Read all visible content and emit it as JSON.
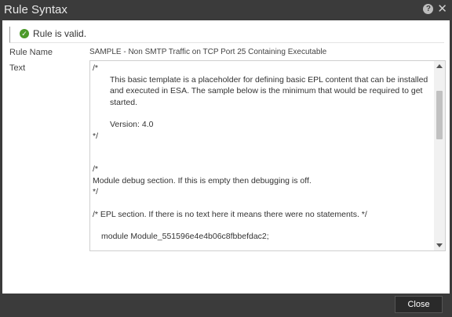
{
  "dialog": {
    "title": "Rule Syntax",
    "help_icon": "?",
    "close_icon": "✕"
  },
  "status": {
    "message": "Rule is valid.",
    "icon": "check-circle-icon"
  },
  "fields": {
    "rule_name_label": "Rule Name",
    "rule_name_value": "SAMPLE - Non SMTP Traffic on TCP Port 25 Containing Executable",
    "text_label": "Text"
  },
  "code": {
    "l1": "/*",
    "l2": "This basic template is a placeholder for defining basic EPL content that can be installed and executed in ESA. The sample below is the minimum that would be required to get started.",
    "l3": "Version:  4.0",
    "l4": "*/",
    "l5": "/*",
    "l6": "Module debug section. If this is empty then debugging is off.",
    "l7": "*/",
    "l8": "/* EPL section. If there is no text here it means there were no statements. */",
    "l9": "module Module_551596e4e4b06c8fbbefdac2;"
  },
  "footer": {
    "close_label": "Close"
  }
}
